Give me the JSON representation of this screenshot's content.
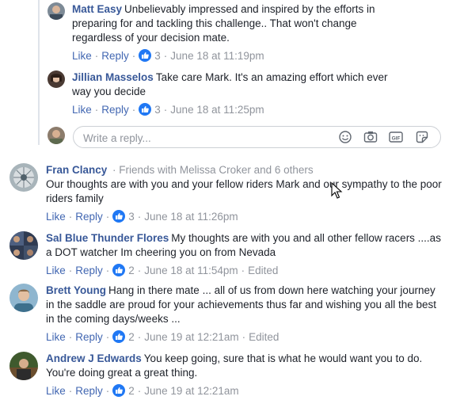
{
  "comments": [
    {
      "author": "Matt Easy",
      "text": "Unbelievably impressed and inspired by the efforts in preparing for and tackling this challenge.. That won't change regardless of your decision mate.",
      "like": "Like",
      "reply": "Reply",
      "reactions": "3",
      "time": "June 18 at 11:19pm"
    },
    {
      "author": "Jillian Masselos",
      "text": "Take care Mark. It's an amazing effort which ever way you decide",
      "like": "Like",
      "reply": "Reply",
      "reactions": "3",
      "time": "June 18 at 11:25pm"
    },
    {
      "author": "Fran Clancy",
      "meta": "· Friends with Melissa Croker and 6 others",
      "text": "Our thoughts are with you and your fellow riders Mark and our sympathy to the poor riders family",
      "like": "Like",
      "reply": "Reply",
      "reactions": "3",
      "time": "June 18 at 11:26pm"
    },
    {
      "author": "Sal Blue Thunder Flores",
      "text": "My thoughts are with you and all other fellow racers ....as a DOT watcher Im cheering you on from Nevada",
      "like": "Like",
      "reply": "Reply",
      "reactions": "2",
      "time": "June 18 at 11:54pm",
      "edited": "Edited"
    },
    {
      "author": "Brett Young",
      "text": "Hang in there mate ... all of us from down here watching your journey in the saddle are proud for your achievements thus far and wishing you all the best in the coming days/weeks ...",
      "like": "Like",
      "reply": "Reply",
      "reactions": "2",
      "time": "June 19 at 12:21am",
      "edited": "Edited"
    },
    {
      "author": "Andrew J Edwards",
      "text": "You keep going, sure that is what he would want you to do. You're doing great a great thing.",
      "like": "Like",
      "reply": "Reply",
      "reactions": "2",
      "time": "June 19 at 12:21am"
    }
  ],
  "reply_box": {
    "placeholder": "Write a reply..."
  },
  "icons": {
    "emoji": "emoji-icon",
    "camera": "camera-icon",
    "gif": "gif-icon",
    "sticker": "sticker-icon",
    "like_badge": "thumbs-up-icon",
    "cursor": "mouse-pointer-icon"
  },
  "colors": {
    "link": "#385898",
    "action": "#4267b2",
    "meta": "#90949c",
    "like_badge": "#2078f4"
  }
}
